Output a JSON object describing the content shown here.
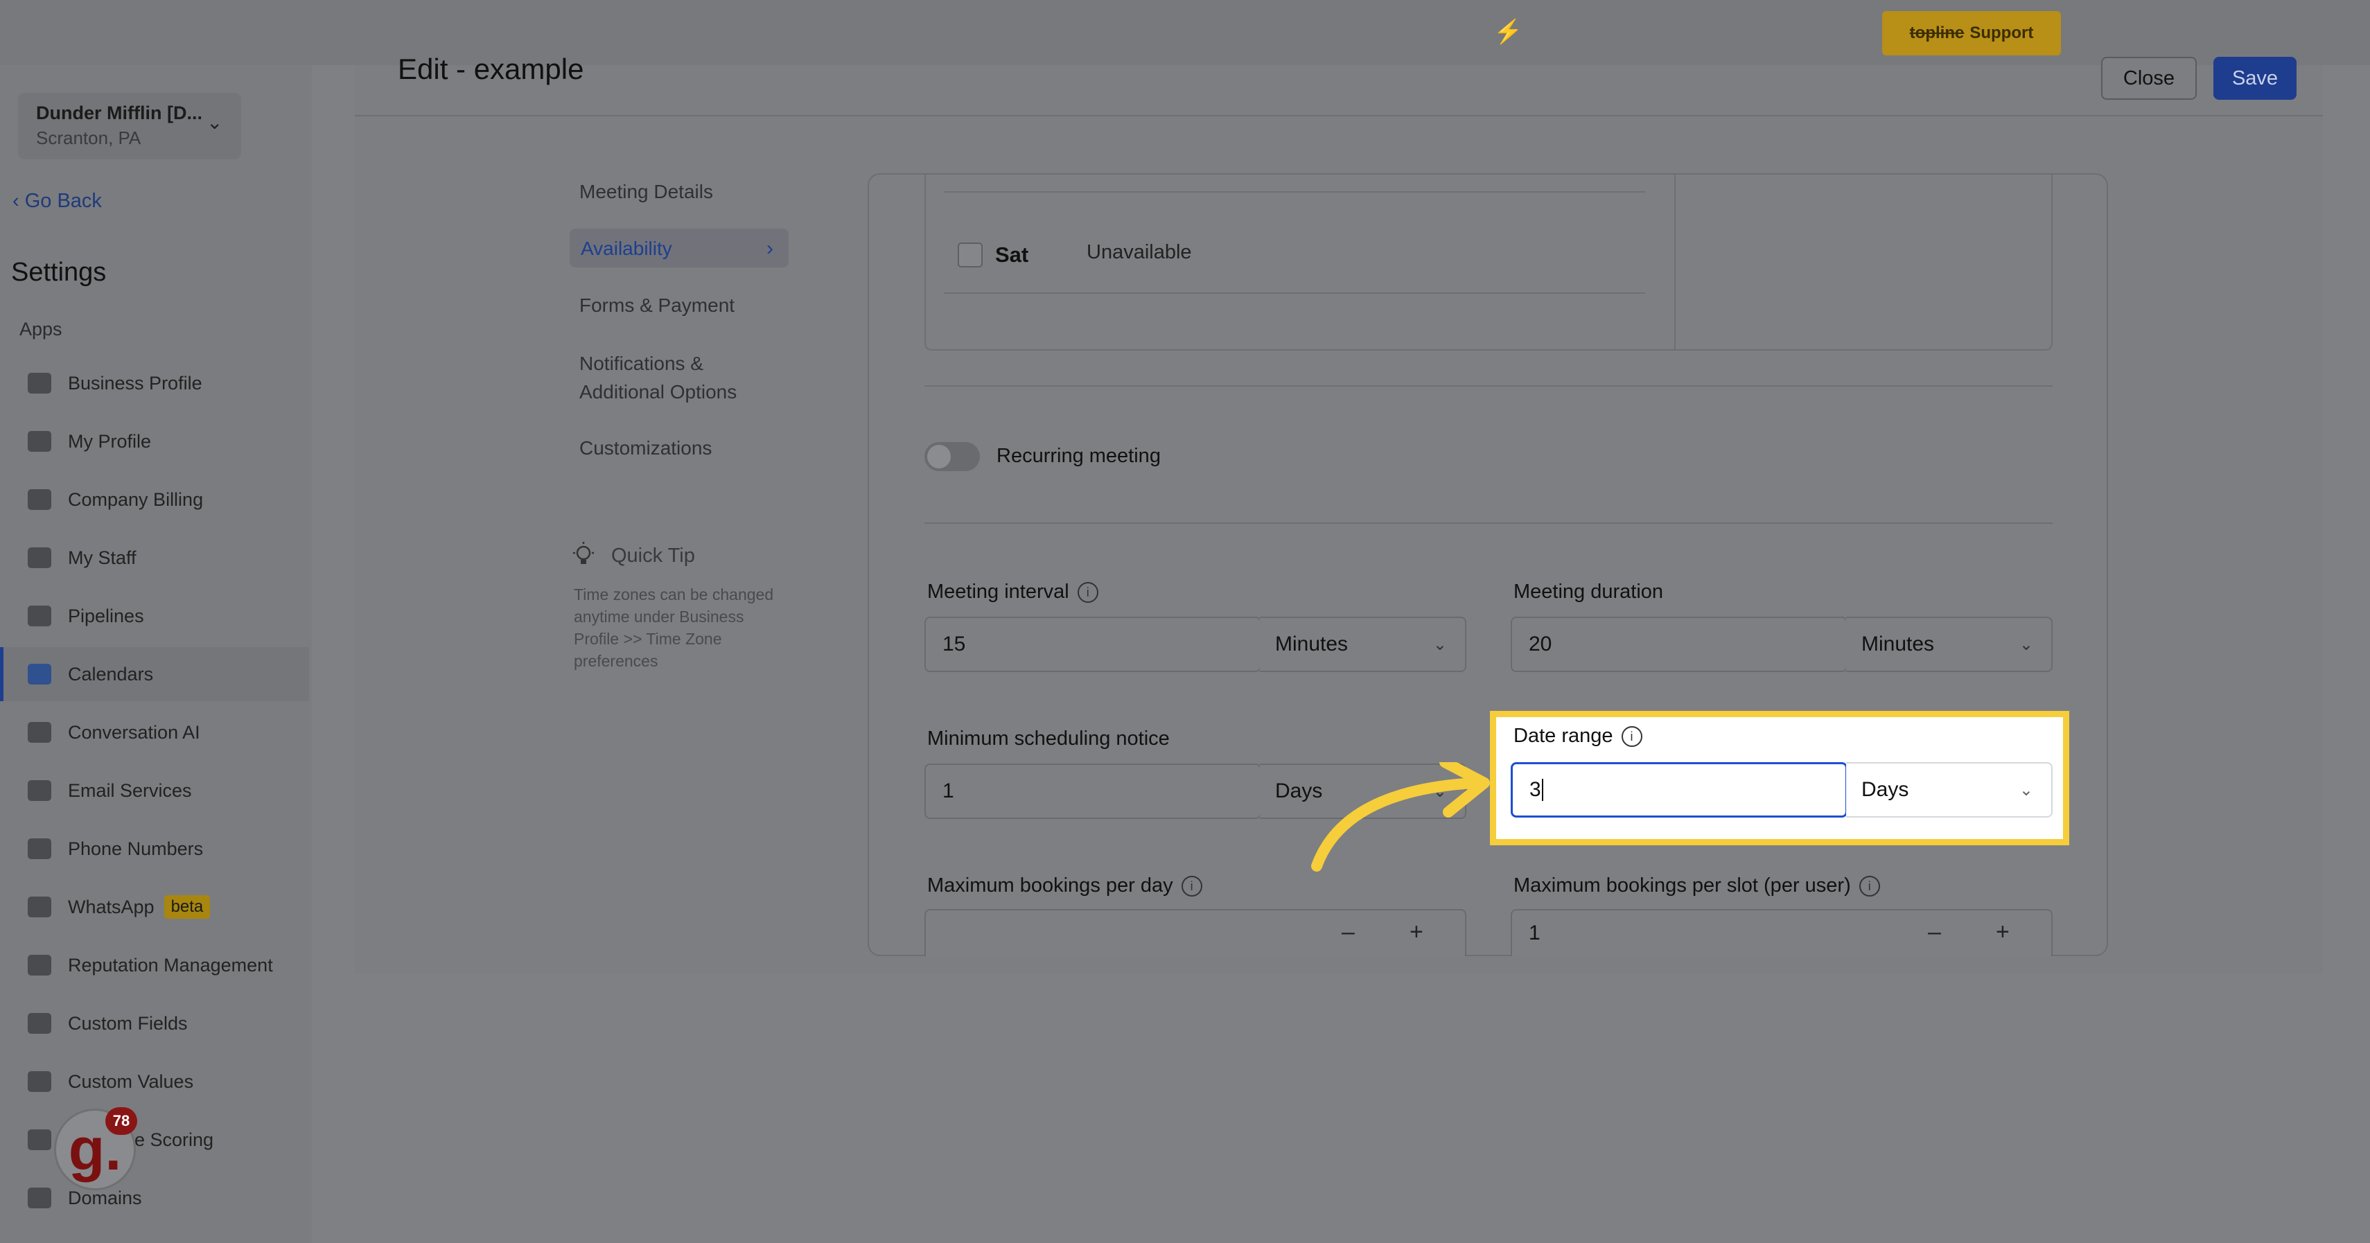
{
  "topbar": {
    "support_brand": "topline",
    "support_label": "Support"
  },
  "sidebar": {
    "location_name": "Dunder Mifflin [D...",
    "location_sub": "Scranton, PA",
    "go_back": "Go Back",
    "title": "Settings",
    "section": "Apps",
    "items": [
      {
        "label": "Business Profile",
        "icon": "briefcase-icon"
      },
      {
        "label": "My Profile",
        "icon": "user-icon"
      },
      {
        "label": "Company Billing",
        "icon": "grid-icon"
      },
      {
        "label": "My Staff",
        "icon": "inbox-icon"
      },
      {
        "label": "Pipelines",
        "icon": "filter-icon"
      },
      {
        "label": "Calendars",
        "icon": "calendar-icon"
      },
      {
        "label": "Conversation AI",
        "icon": "chat-icon"
      },
      {
        "label": "Email Services",
        "icon": "mail-icon"
      },
      {
        "label": "Phone Numbers",
        "icon": "phone-icon"
      },
      {
        "label": "WhatsApp",
        "icon": "whatsapp-icon",
        "badge": "beta"
      },
      {
        "label": "Reputation Management",
        "icon": "star-icon"
      },
      {
        "label": "Custom Fields",
        "icon": "edit-icon"
      },
      {
        "label": "Custom Values",
        "icon": "pie-icon"
      },
      {
        "label": "e Scoring",
        "icon": "chart-icon"
      },
      {
        "label": "Domains",
        "icon": "domain-icon"
      }
    ],
    "active_item": "Calendars",
    "badge_letter": "g.",
    "badge_count": "78"
  },
  "header": {
    "title": "Edit - example",
    "close": "Close",
    "save": "Save"
  },
  "tabs": [
    {
      "label": "Meeting Details"
    },
    {
      "label": "Availability"
    },
    {
      "label": "Forms & Payment"
    },
    {
      "label": "Notifications & Additional Options"
    },
    {
      "label": "Customizations"
    }
  ],
  "quick_tip": {
    "title": "Quick Tip",
    "body": "Time zones can be changed anytime under Business Profile >> Time Zone preferences"
  },
  "availability": {
    "day": "Sat",
    "status": "Unavailable"
  },
  "recurring": {
    "label": "Recurring meeting"
  },
  "meeting_interval": {
    "label": "Meeting interval",
    "value": "15",
    "unit": "Minutes"
  },
  "meeting_duration": {
    "label": "Meeting duration",
    "value": "20",
    "unit": "Minutes"
  },
  "min_notice": {
    "label": "Minimum scheduling notice",
    "value": "1",
    "unit": "Days"
  },
  "date_range": {
    "label": "Date range",
    "value": "3",
    "unit": "Days"
  },
  "max_per_day": {
    "label": "Maximum bookings per day",
    "value": ""
  },
  "max_per_slot": {
    "label": "Maximum bookings per slot (per user)",
    "value": "1"
  },
  "colors": {
    "accent": "#1d3f8f",
    "highlight": "#f6cd3a",
    "focus": "#1e4fd1"
  }
}
